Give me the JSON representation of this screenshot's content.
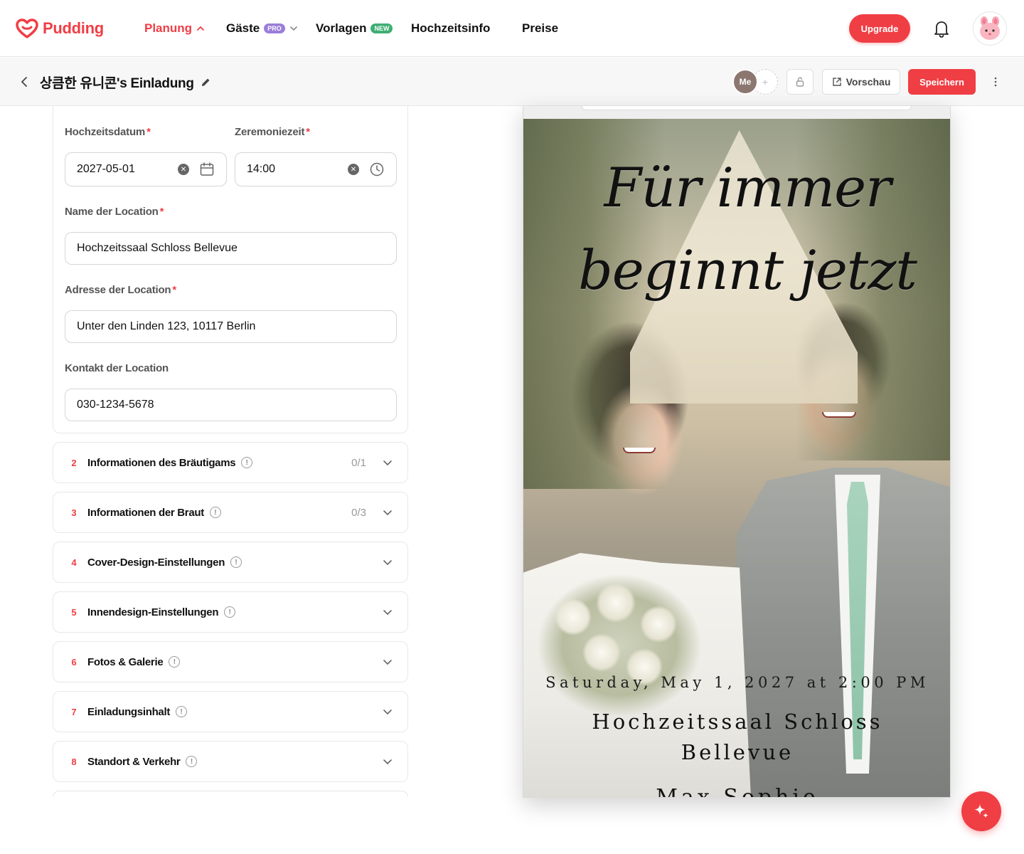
{
  "app": {
    "brand": "Pudding",
    "brand_color": "#f03e45"
  },
  "nav": {
    "items": [
      {
        "label": "Planung",
        "active": true
      },
      {
        "label": "Gäste",
        "badge": "PRO"
      },
      {
        "label": "Vorlagen",
        "badge": "NEW"
      },
      {
        "label": "Hochzeitsinfo"
      },
      {
        "label": "Preise"
      }
    ],
    "upgrade_label": "Upgrade"
  },
  "toolbar": {
    "title": "상큼한 유니콘's Einladung",
    "me_label": "Me",
    "add_label": "+",
    "preview_label": "Vorschau",
    "save_label": "Speichern"
  },
  "form": {
    "date_label": "Hochzeitsdatum",
    "date_value": "2027-05-01",
    "time_label": "Zeremoniezeit",
    "time_value": "14:00",
    "location_name_label": "Name der Location",
    "location_name_value": "Hochzeitssaal Schloss Bellevue",
    "location_address_label": "Adresse der Location",
    "location_address_value": "Unter den Linden 123, 10117 Berlin",
    "location_contact_label": "Kontakt der Location",
    "location_contact_value": "030-1234-5678",
    "required_mark": "*"
  },
  "sections": [
    {
      "num": "2",
      "title": "Informationen des Bräutigams",
      "count": "0/1"
    },
    {
      "num": "3",
      "title": "Informationen der Braut",
      "count": "0/3"
    },
    {
      "num": "4",
      "title": "Cover-Design-Einstellungen",
      "count": ""
    },
    {
      "num": "5",
      "title": "Innendesign-Einstellungen",
      "count": ""
    },
    {
      "num": "6",
      "title": "Fotos & Galerie",
      "count": ""
    },
    {
      "num": "7",
      "title": "Einladungsinhalt",
      "count": ""
    },
    {
      "num": "8",
      "title": "Standort & Verkehr",
      "count": ""
    }
  ],
  "preview": {
    "script_line_1": "Für immer",
    "script_line_2": "beginnt jetzt",
    "date_text": "Saturday, May 1, 2027 at 2:00 PM",
    "venue_text": "Hochzeitssaal Schloss Bellevue",
    "names_text": "Max   Sophie"
  },
  "icons": {
    "logo": "heart-logo-icon",
    "bell": "bell-icon",
    "avatar": "bunny-avatar-icon",
    "fab": "sparkle-icon"
  }
}
